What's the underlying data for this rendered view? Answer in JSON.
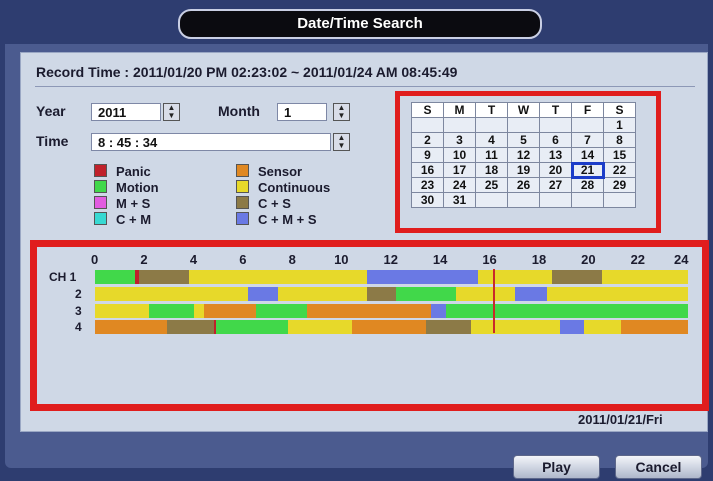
{
  "window": {
    "title": "Date/Time Search"
  },
  "record_time": {
    "text": "Record Time : 2011/01/20 PM 02:23:02 ~ 2011/01/24 AM 08:45:49"
  },
  "form": {
    "year_label": "Year",
    "year_value": "2011",
    "month_label": "Month",
    "month_value": "1",
    "time_label": "Time",
    "time_value": "8 : 45 : 34"
  },
  "legend": [
    {
      "label": "Panic",
      "color": "#c0212b"
    },
    {
      "label": "Sensor",
      "color": "#e08822"
    },
    {
      "label": "Motion",
      "color": "#41d84a"
    },
    {
      "label": "Continuous",
      "color": "#e7d92a"
    },
    {
      "label": "M + S",
      "color": "#e25ce0"
    },
    {
      "label": "C + S",
      "color": "#8c7a47"
    },
    {
      "label": "C + M",
      "color": "#38d9d2"
    },
    {
      "label": "C + M + S",
      "color": "#6a79e4"
    }
  ],
  "calendar": {
    "headers": [
      "S",
      "M",
      "T",
      "W",
      "T",
      "F",
      "S"
    ],
    "weeks": [
      [
        "",
        "",
        "",
        "",
        "",
        "",
        "1"
      ],
      [
        "2",
        "3",
        "4",
        "5",
        "6",
        "7",
        "8"
      ],
      [
        "9",
        "10",
        "11",
        "12",
        "13",
        "14",
        "15"
      ],
      [
        "16",
        "17",
        "18",
        "19",
        "20",
        "21",
        "22"
      ],
      [
        "23",
        "24",
        "25",
        "26",
        "27",
        "28",
        "29"
      ],
      [
        "30",
        "31",
        "",
        "",
        "",
        "",
        ""
      ]
    ],
    "red_days": [
      "20",
      "24"
    ],
    "selected_day": "21"
  },
  "timeline": {
    "hours": [
      "0",
      "2",
      "4",
      "6",
      "8",
      "10",
      "12",
      "14",
      "16",
      "18",
      "20",
      "22",
      "24"
    ],
    "channels": [
      {
        "label": "CH 1",
        "segments": [
          {
            "start": 0,
            "end": 1.6,
            "color": "#41d84a"
          },
          {
            "start": 1.6,
            "end": 1.8,
            "color": "#c0212b"
          },
          {
            "start": 1.8,
            "end": 3.8,
            "color": "#8c7a47"
          },
          {
            "start": 3.8,
            "end": 11,
            "color": "#e7d92a"
          },
          {
            "start": 11,
            "end": 15.5,
            "color": "#6a79e4"
          },
          {
            "start": 15.5,
            "end": 18.5,
            "color": "#e7d92a"
          },
          {
            "start": 18.5,
            "end": 20.5,
            "color": "#8c7a47"
          },
          {
            "start": 20.5,
            "end": 24,
            "color": "#e7d92a"
          }
        ]
      },
      {
        "label": "2",
        "segments": [
          {
            "start": 0,
            "end": 6.2,
            "color": "#e7d92a"
          },
          {
            "start": 6.2,
            "end": 7.4,
            "color": "#6a79e4"
          },
          {
            "start": 7.4,
            "end": 11,
            "color": "#e7d92a"
          },
          {
            "start": 11,
            "end": 12.2,
            "color": "#8c7a47"
          },
          {
            "start": 12.2,
            "end": 14.6,
            "color": "#41d84a"
          },
          {
            "start": 14.6,
            "end": 17,
            "color": "#e7d92a"
          },
          {
            "start": 17,
            "end": 18.3,
            "color": "#6a79e4"
          },
          {
            "start": 18.3,
            "end": 24,
            "color": "#e7d92a"
          }
        ]
      },
      {
        "label": "3",
        "segments": [
          {
            "start": 0,
            "end": 2.2,
            "color": "#e7d92a"
          },
          {
            "start": 2.2,
            "end": 4,
            "color": "#41d84a"
          },
          {
            "start": 4,
            "end": 4.4,
            "color": "#e7d92a"
          },
          {
            "start": 4.4,
            "end": 6.5,
            "color": "#e08822"
          },
          {
            "start": 6.5,
            "end": 8.6,
            "color": "#41d84a"
          },
          {
            "start": 8.6,
            "end": 13.6,
            "color": "#e08822"
          },
          {
            "start": 13.6,
            "end": 14.2,
            "color": "#6a79e4"
          },
          {
            "start": 14.2,
            "end": 24,
            "color": "#41d84a"
          }
        ]
      },
      {
        "label": "4",
        "segments": [
          {
            "start": 0,
            "end": 2.9,
            "color": "#e08822"
          },
          {
            "start": 2.9,
            "end": 4.8,
            "color": "#8c7a47"
          },
          {
            "start": 4.8,
            "end": 4.9,
            "color": "#c0212b"
          },
          {
            "start": 4.9,
            "end": 7.8,
            "color": "#41d84a"
          },
          {
            "start": 7.8,
            "end": 10.4,
            "color": "#e7d92a"
          },
          {
            "start": 10.4,
            "end": 13.4,
            "color": "#e08822"
          },
          {
            "start": 13.4,
            "end": 15.2,
            "color": "#8c7a47"
          },
          {
            "start": 15.2,
            "end": 18.8,
            "color": "#e7d92a"
          },
          {
            "start": 18.8,
            "end": 19.8,
            "color": "#6a79e4"
          },
          {
            "start": 19.8,
            "end": 21.3,
            "color": "#e7d92a"
          },
          {
            "start": 21.3,
            "end": 24,
            "color": "#e08822"
          }
        ]
      }
    ],
    "cursor_hour": 16.1,
    "date_label": "2011/01/21/Fri"
  },
  "buttons": {
    "play": "Play",
    "cancel": "Cancel"
  }
}
